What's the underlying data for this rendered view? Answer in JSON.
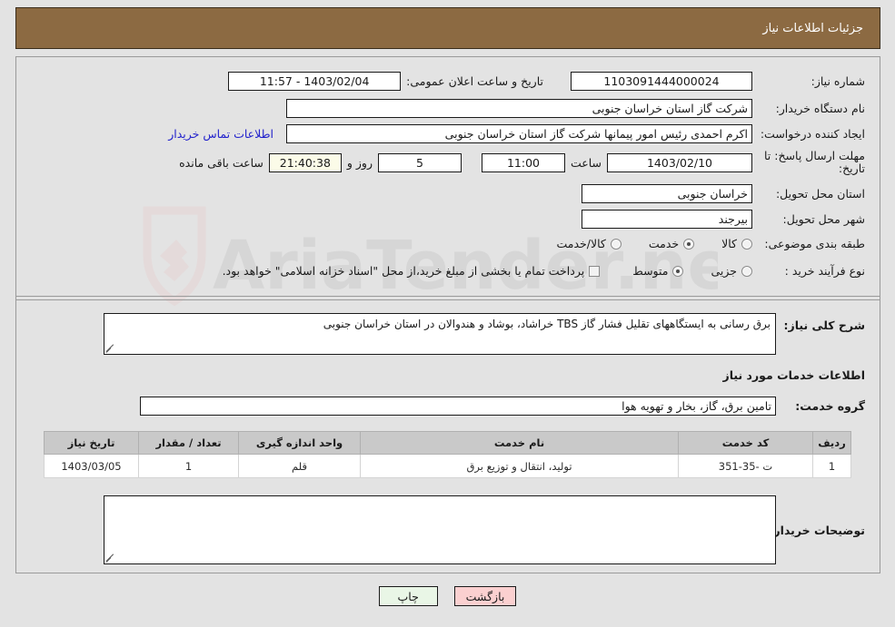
{
  "header": {
    "title": "جزئیات اطلاعات نیاز"
  },
  "watermark": {
    "text": "AriaTender.net",
    "shield_color": "#e8bcbc",
    "text_color": "#b9b9b9"
  },
  "colors": {
    "header_bg": "#8c6a42",
    "page_bg": "#e3e3e3",
    "link": "#2222cc",
    "timer_bg": "#fbfbe8",
    "table_header_bg": "#c9c9c9",
    "print_button_bg": "#e9f6e6",
    "back_button_bg": "#fbd0d0"
  },
  "form": {
    "need_number_label": "شماره نیاز:",
    "need_number_value": "1103091444000024",
    "announce_datetime_label": "تاریخ و ساعت اعلان عمومی:",
    "announce_datetime_value": "1403/02/04 - 11:57",
    "buyer_org_label": "نام دستگاه خریدار:",
    "buyer_org_value": "شرکت گاز استان خراسان جنوبی",
    "requester_label": "ایجاد کننده درخواست:",
    "requester_value": "اکرم احمدی رئیس امور پیمانها شرکت گاز استان خراسان جنوبی",
    "buyer_contact_link": "اطلاعات تماس خریدار",
    "deadline_label": "مهلت ارسال پاسخ: تا تاریخ:",
    "deadline_date": "1403/02/10",
    "hour_label": "ساعت",
    "deadline_time": "11:00",
    "days_value": "5",
    "days_label": "روز و",
    "countdown_value": "21:40:38",
    "remaining_label": "ساعت باقی مانده",
    "delivery_province_label": "استان محل تحویل:",
    "delivery_province_value": "خراسان جنوبی",
    "delivery_city_label": "شهر محل تحویل:",
    "delivery_city_value": "بیرجند",
    "category_label": "طبقه بندی موضوعی:",
    "category_options": [
      {
        "label": "کالا",
        "checked": false
      },
      {
        "label": "خدمت",
        "checked": true
      },
      {
        "label": "کالا/خدمت",
        "checked": false
      }
    ],
    "process_type_label": "نوع فرآیند خرید :",
    "process_type_options": [
      {
        "label": "جزیی",
        "checked": false
      },
      {
        "label": "متوسط",
        "checked": true
      }
    ],
    "islamic_treasury_checked": false,
    "islamic_treasury_label": "پرداخت تمام یا بخشی از مبلغ خرید،از محل \"اسناد خزانه اسلامی\" خواهد بود."
  },
  "description": {
    "label": "شرح کلی نیاز:",
    "value": "برق رسانی به ایستگاههای تقلیل فشار گاز TBS خراشاد، بوشاد و هندوالان  در استان خراسان جنوبی"
  },
  "services": {
    "section_title": "اطلاعات خدمات مورد نیاز",
    "group_label": "گروه خدمت:",
    "group_value": "تامین برق، گاز، بخار و تهویه هوا",
    "table": {
      "columns": [
        "ردیف",
        "کد خدمت",
        "نام خدمت",
        "واحد اندازه گیری",
        "تعداد / مقدار",
        "تاریخ نیاز"
      ],
      "rows": [
        [
          "1",
          "ت -35-351",
          "تولید، انتقال و توزیع برق",
          "قلم",
          "1",
          "1403/03/05"
        ]
      ]
    }
  },
  "buyer_notes": {
    "label": "توضیحات خریدار;",
    "value": ""
  },
  "buttons": {
    "print": "چاپ",
    "back": "بازگشت"
  }
}
